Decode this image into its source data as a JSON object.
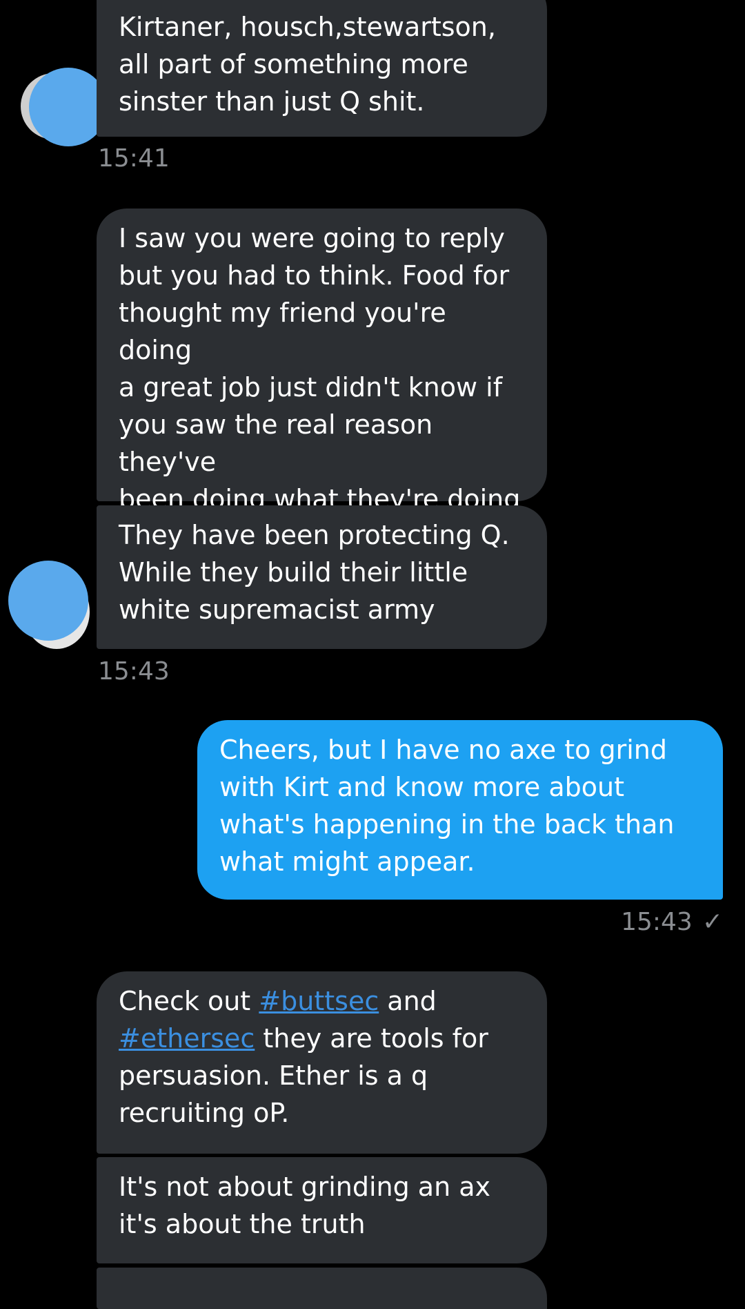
{
  "conversation": {
    "messages": [
      {
        "sender": "them",
        "text": "Kirtaner, housch,stewartson,\nall part of something more\nsinster than just Q shit."
      },
      {
        "sender": "them",
        "text": "I saw you were going to reply\nbut you had to think. Food for\nthought my friend you're doing\na great job just didn't know if\nyou saw the real reason they've\nbeen doing what they're doing\nit's all a distraction"
      },
      {
        "sender": "them",
        "text": "They have been protecting Q.\nWhile they build their little\nwhite supremacist army"
      },
      {
        "sender": "me",
        "text": "Cheers, but I have no axe to grind\nwith Kirt and know more about\nwhat's happening in the back than\nwhat might appear."
      },
      {
        "sender": "them",
        "segments": [
          {
            "text": "Check out ",
            "type": "plain"
          },
          {
            "text": "#buttsec",
            "type": "hashtag"
          },
          {
            "text": " and\n",
            "type": "plain"
          },
          {
            "text": "#ethersec",
            "type": "hashtag"
          },
          {
            "text": " they are tools for\npersuasion. Ether is a q\nrecruiting oP.",
            "type": "plain"
          }
        ]
      },
      {
        "sender": "them",
        "text": "It's not about grinding an ax\nit's about the truth"
      }
    ],
    "timestamps": {
      "t1": "15:41",
      "t2": "15:43",
      "t3": "15:43"
    },
    "read_mark": "✓"
  },
  "colors": {
    "background": "#000000",
    "incoming_bubble": "#2c2f33",
    "outgoing_bubble": "#1da1f2",
    "timestamp": "#8a8d91",
    "hashtag": "#3b8fe0",
    "avatar_redaction": "#5aa9ec"
  }
}
